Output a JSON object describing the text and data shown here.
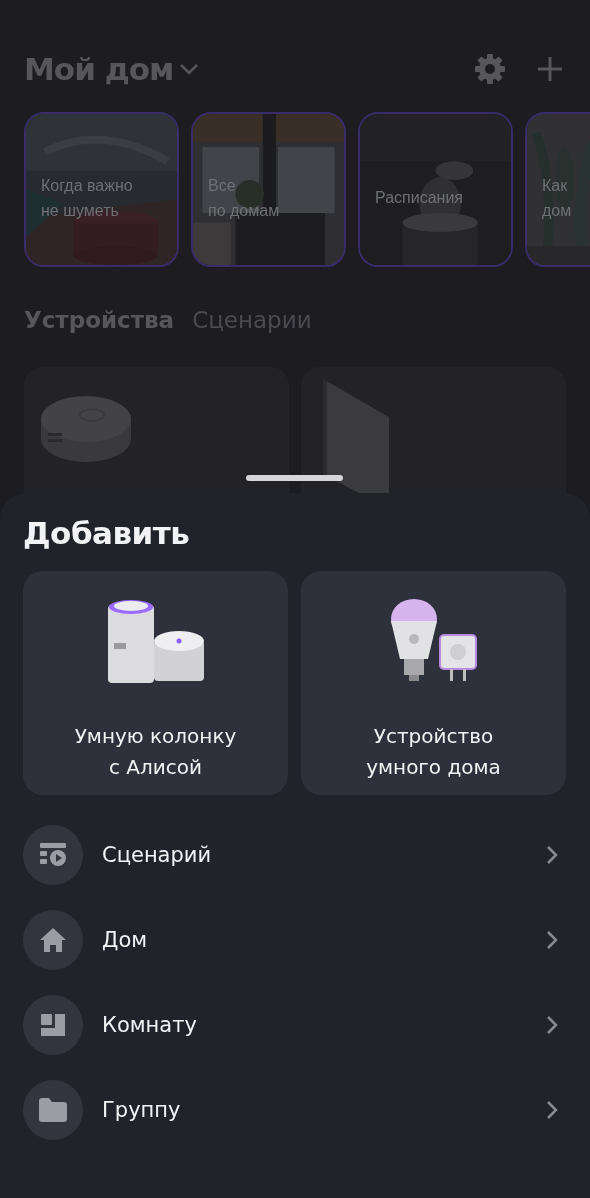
{
  "header": {
    "title": "Мой дом"
  },
  "stories": [
    {
      "lines": [
        "Когда важно",
        "не шуметь"
      ]
    },
    {
      "lines": [
        "Все",
        "по домам"
      ]
    },
    {
      "lines": [
        "Расписания"
      ]
    },
    {
      "lines": [
        "Как",
        "дом"
      ]
    }
  ],
  "tabs": [
    {
      "label": "Устройства",
      "selected": true
    },
    {
      "label": "Сценарии",
      "selected": false
    }
  ],
  "devices": [
    {
      "kind": "sensor"
    },
    {
      "kind": "panel"
    }
  ],
  "sheet": {
    "title": "Добавить",
    "options": [
      {
        "kind": "speaker",
        "lines": [
          "Умную колонку",
          "с Алисой"
        ]
      },
      {
        "kind": "smart-device",
        "lines": [
          "Устройство",
          "умного дома"
        ]
      }
    ],
    "items": [
      {
        "kind": "scenario",
        "label": "Сценарий"
      },
      {
        "kind": "home",
        "label": "Дом"
      },
      {
        "kind": "room",
        "label": "Комнату"
      },
      {
        "kind": "group",
        "label": "Группу"
      }
    ]
  }
}
